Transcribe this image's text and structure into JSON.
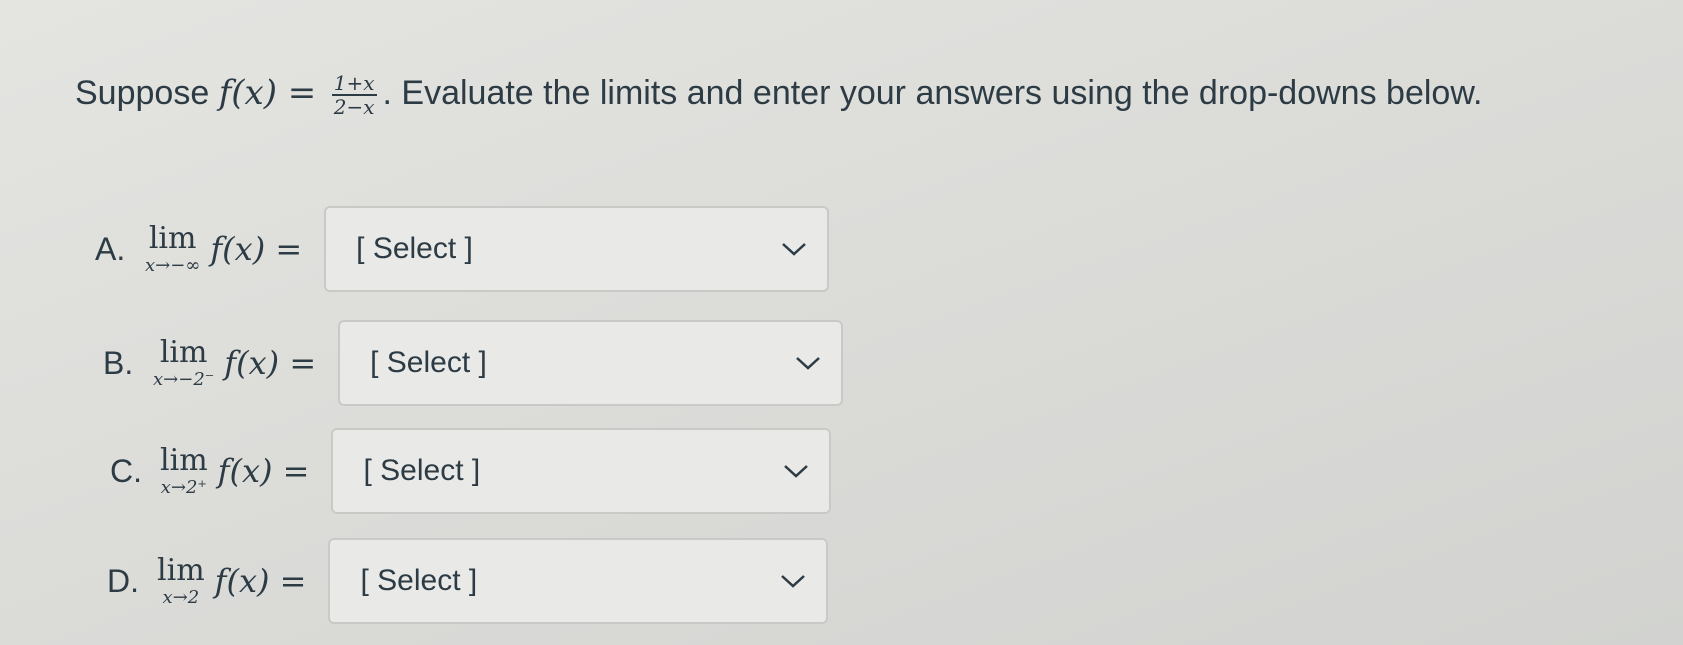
{
  "question": {
    "prefix": "Suppose",
    "fx_lhs": "f(x) =",
    "numerator": "1+x",
    "denominator": "2−x",
    "suffix": ". Evaluate the limits and enter your answers using the drop-downs below."
  },
  "items": [
    {
      "letter": "A.",
      "lim": "lim",
      "sub": "x→−∞",
      "fx": "f(x) =",
      "select_label": "[ Select ]"
    },
    {
      "letter": "B.",
      "lim": "lim",
      "sub": "x→−2⁻",
      "fx": "f(x) =",
      "select_label": "[ Select ]"
    },
    {
      "letter": "C.",
      "lim": "lim",
      "sub": "x→2⁺",
      "fx": "f(x) =",
      "select_label": "[ Select ]"
    },
    {
      "letter": "D.",
      "lim": "lim",
      "sub": "x→2",
      "fx": "f(x) =",
      "select_label": "[ Select ]"
    }
  ],
  "icons": {
    "dropdown": "chevron-down-icon"
  }
}
